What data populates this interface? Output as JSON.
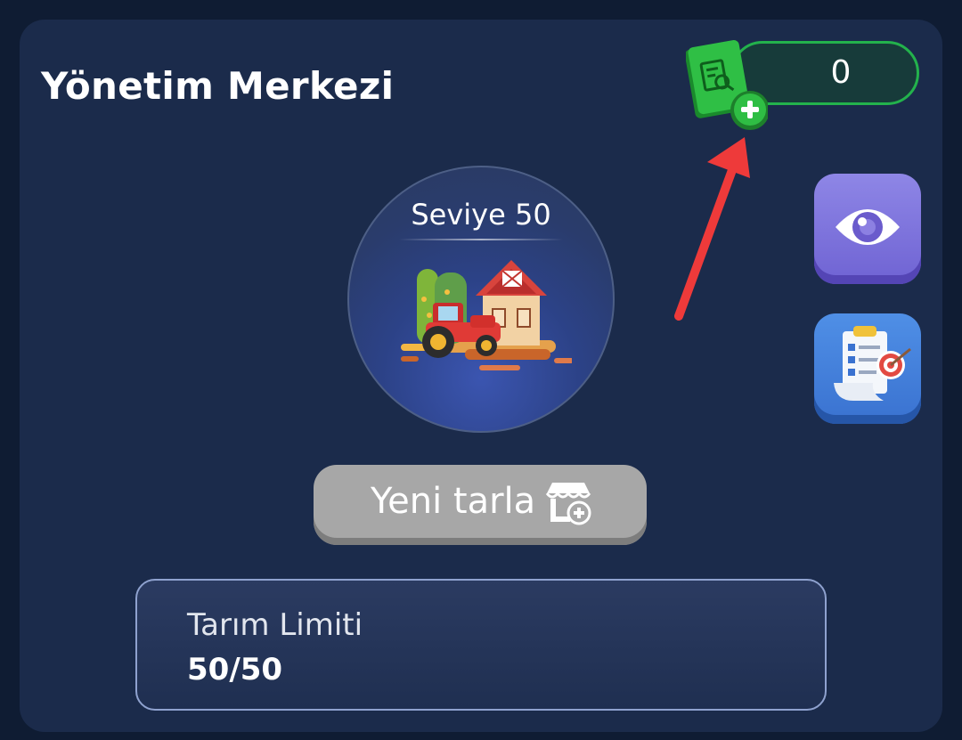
{
  "header": {
    "title": "Yönetim Merkezi"
  },
  "currency": {
    "value": "0",
    "icon": "document-search-icon",
    "add_icon": "plus-icon",
    "accent": "#23b24c"
  },
  "level": {
    "label": "Seviye 50",
    "illustration": "farm-tractor-illustration"
  },
  "side_buttons": [
    {
      "icon": "eye-icon",
      "color": "#7b6fdc"
    },
    {
      "icon": "checklist-target-icon",
      "color": "#4581dc"
    }
  ],
  "new_field": {
    "label": "Yeni tarla",
    "icon": "shop-add-icon"
  },
  "limit": {
    "label": "Tarım Limiti",
    "value": "50/50"
  },
  "annotation": {
    "arrow_color": "#ee3a3a"
  }
}
